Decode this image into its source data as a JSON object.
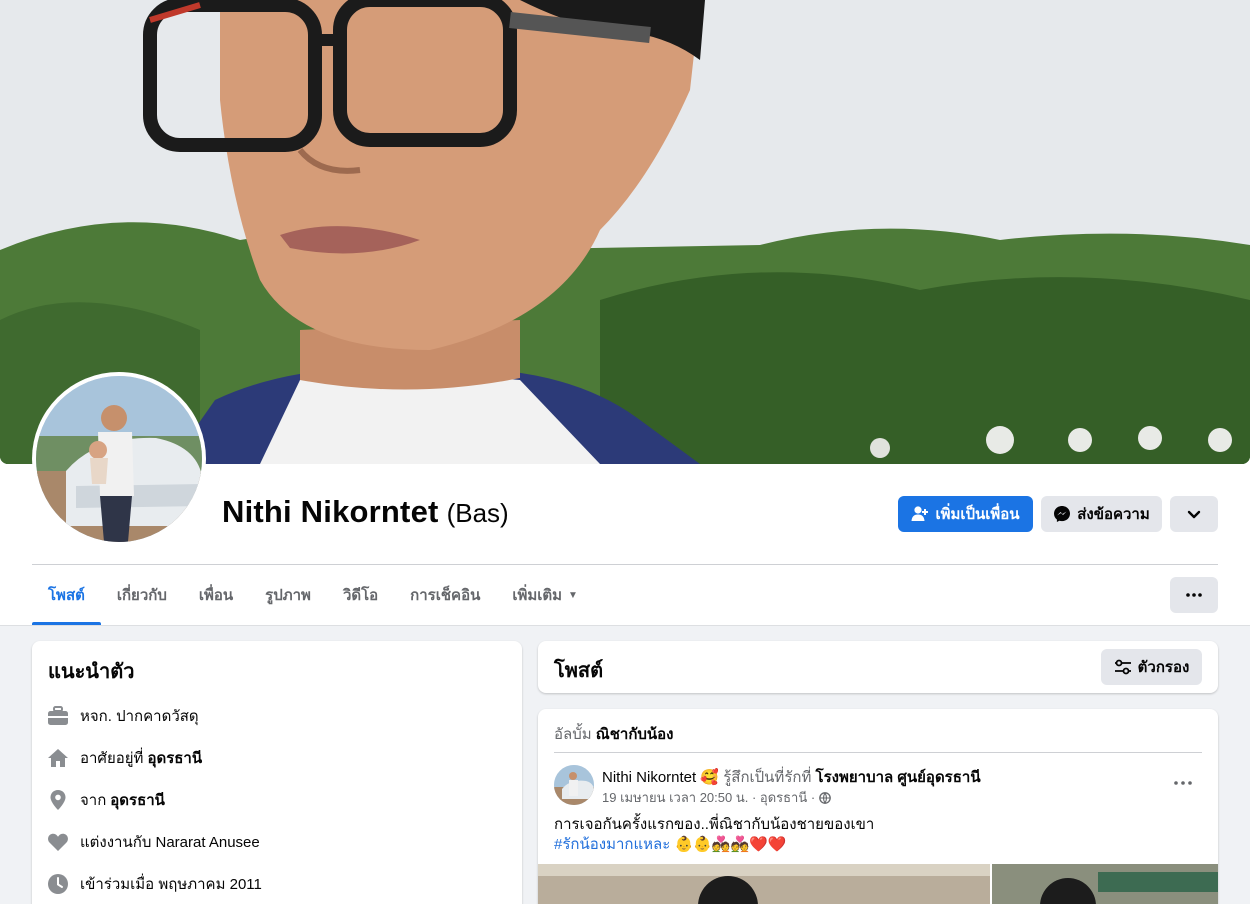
{
  "profile": {
    "name": "Nithi Nikorntet",
    "alternate_name": "(Bas)"
  },
  "actions": {
    "add_friend_label": "เพิ่มเป็นเพื่อน",
    "message_label": "ส่งข้อความ",
    "accent_color": "#1b74e4"
  },
  "tabs": [
    {
      "label": "โพสต์",
      "active": true
    },
    {
      "label": "เกี่ยวกับ",
      "active": false
    },
    {
      "label": "เพื่อน",
      "active": false
    },
    {
      "label": "รูปภาพ",
      "active": false
    },
    {
      "label": "วิดีโอ",
      "active": false
    },
    {
      "label": "การเช็คอิน",
      "active": false
    },
    {
      "label": "เพิ่มเติม",
      "active": false
    }
  ],
  "intro": {
    "title": "แนะนำตัว",
    "items": [
      {
        "icon": "briefcase-icon",
        "text": "หจก. ปากคาดวัสดุ",
        "bold": ""
      },
      {
        "icon": "home-icon",
        "text": "อาศัยอยู่ที่",
        "bold": "อุดรธานี"
      },
      {
        "icon": "location-pin-icon",
        "text": "จาก",
        "bold": "อุดรธานี"
      },
      {
        "icon": "heart-icon",
        "text": "แต่งงานกับ Nararat Anusee",
        "bold": ""
      },
      {
        "icon": "clock-icon",
        "text": "เข้าร่วมเมื่อ พฤษภาคม 2011",
        "bold": ""
      }
    ]
  },
  "posts_header": {
    "title": "โพสต์",
    "filter_label": "ตัวกรอง"
  },
  "post": {
    "album_prefix": "อัลบั้ม",
    "album_name": "ณิชากับน้อง",
    "author": "Nithi Nikorntet",
    "feeling_emoji": "🥰",
    "feeling_text": "รู้สึกเป็นที่รักที่",
    "place": "โรงพยาบาล ศูนย์อุดรธานี",
    "timestamp": "19 เมษายน เวลา 20:50 น. · อุดรธานี ·",
    "privacy_icon": "globe-icon",
    "text": "การเจอกันครั้งแรกของ..พี่ณิชากับน้องชายของเขา",
    "hashtag": "#รักน้องมากแหละ",
    "emojis": "👶👶💑💑❤️❤️"
  }
}
